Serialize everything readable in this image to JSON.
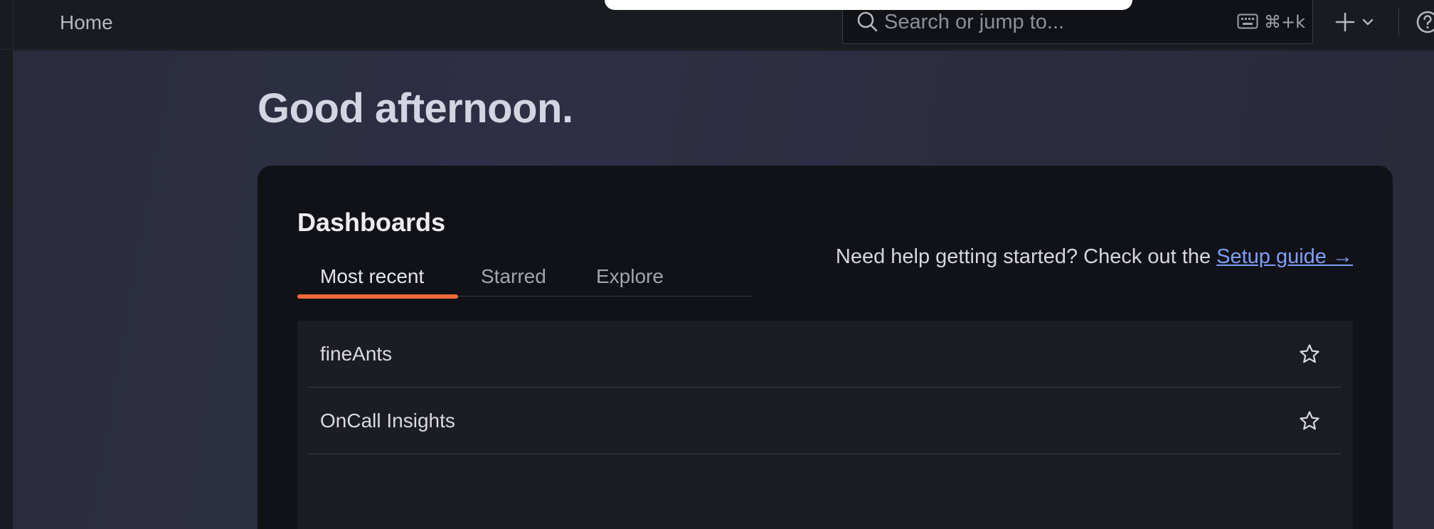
{
  "topbar": {
    "breadcrumb": "Home",
    "search_placeholder": "Search or jump to...",
    "search_shortcut": "⌘+k",
    "icons": [
      "search-icon",
      "keyboard-icon",
      "plus-icon",
      "chevron-down-icon",
      "help-icon"
    ]
  },
  "greeting": "Good afternoon.",
  "dashboards": {
    "title": "Dashboards",
    "tabs": [
      {
        "label": "Most recent",
        "active": true
      },
      {
        "label": "Starred",
        "active": false
      },
      {
        "label": "Explore",
        "active": false
      }
    ],
    "help_text": "Need help getting started? Check out the ",
    "setup_link": "Setup guide →",
    "items": [
      {
        "name": "fineAnts",
        "starred": false
      },
      {
        "name": "OnCall Insights",
        "starred": false
      }
    ]
  },
  "colors": {
    "accent_tab_underline": "#f06a3a",
    "link": "#7f9ff8",
    "card_bg": "#111217",
    "list_bg": "#1c1d22"
  }
}
